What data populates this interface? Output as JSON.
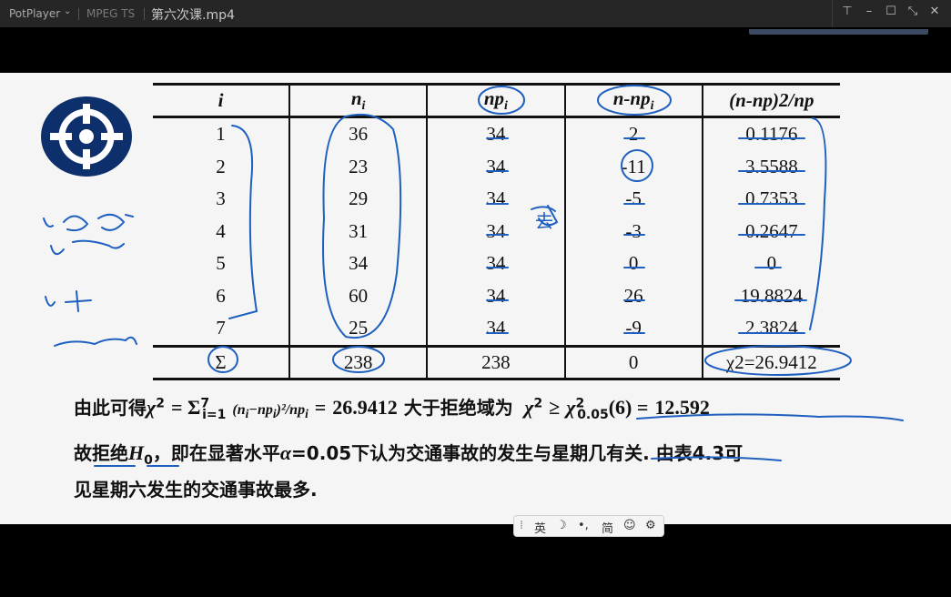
{
  "titlebar": {
    "app_name": "PotPlayer",
    "format": "MPEG TS",
    "filename": "第六次课.mp4"
  },
  "table": {
    "headers": [
      "i",
      "n",
      "np",
      "n-np",
      "(n-np)2/np"
    ],
    "rows": [
      [
        "1",
        "36",
        "34",
        "2",
        "0.1176"
      ],
      [
        "2",
        "23",
        "34",
        "-11",
        "3.5588"
      ],
      [
        "3",
        "29",
        "34",
        "-5",
        "0.7353"
      ],
      [
        "4",
        "31",
        "34",
        "-3",
        "0.2647"
      ],
      [
        "5",
        "34",
        "34",
        "0",
        "0"
      ],
      [
        "6",
        "60",
        "34",
        "26",
        "19.8824"
      ],
      [
        "7",
        "25",
        "34",
        "-9",
        "2.3824"
      ]
    ],
    "total": [
      "Σ",
      "238",
      "238",
      "0",
      "χ2=26.9412"
    ]
  },
  "conclusion": {
    "line1_prefix": "由此可得",
    "value": "26.9412",
    "mid": "大于拒绝域为",
    "critical": "12.592",
    "line2_a": "故拒绝",
    "line2_b": "，即在显著水平",
    "alpha": "=0.05",
    "line2_c": "下认为交通事故的发生与星期几有关. 由表4.3可",
    "line3": "见星期六发生的交通事故最多."
  },
  "annotations": {
    "side_note": "去"
  },
  "ime": {
    "lang": "英",
    "mode": "简"
  },
  "colors": {
    "titlebar_bg": "#262626",
    "slide_bg": "#f4f5f4",
    "ink_blue": "#1f5fbf",
    "logo_navy": "#0d2f6b"
  }
}
